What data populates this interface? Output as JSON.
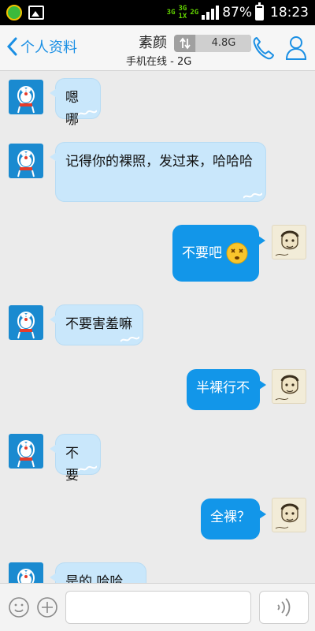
{
  "status_bar": {
    "net_top": "3G",
    "net_mid": "3G",
    "net_mid_sub": "1X",
    "net_right": "2G",
    "battery_percent": "87%",
    "time": "18:23",
    "battery_level": 0.87
  },
  "header": {
    "back_label": "个人资料",
    "contact_name": "素颜",
    "contact_status": "手机在线 - 2G",
    "data_usage": "4.8G",
    "accent_color": "#1a8fe4"
  },
  "messages": [
    {
      "side": "in",
      "text": "嗯哪"
    },
    {
      "side": "in",
      "text": "记得你的裸照，发过来，哈哈哈"
    },
    {
      "side": "out",
      "text": "不要吧",
      "emoji": "dizzy-face"
    },
    {
      "side": "in",
      "text": "不要害羞嘛"
    },
    {
      "side": "out",
      "text": "半裸行不"
    },
    {
      "side": "in",
      "text": "不要"
    },
    {
      "side": "out",
      "text": "全裸？"
    },
    {
      "side": "in",
      "text": "是的 哈哈哈"
    }
  ],
  "input_bar": {
    "placeholder": "",
    "icons": [
      "emoji-icon",
      "plus-icon",
      "voice-icon"
    ]
  }
}
